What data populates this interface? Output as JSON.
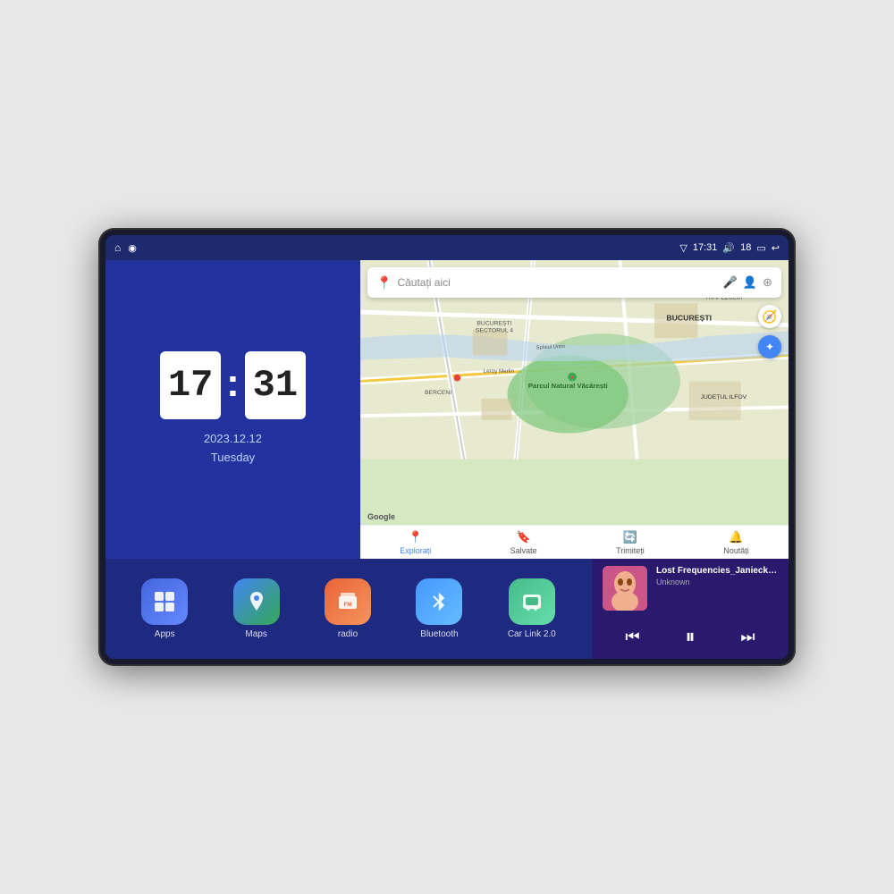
{
  "device": {
    "status_bar": {
      "signal_icon": "▽",
      "time": "17:31",
      "volume_icon": "🔊",
      "battery_level": "18",
      "battery_icon": "▭",
      "back_icon": "↩"
    },
    "home_icon": "⌂",
    "maps_icon": "◉"
  },
  "clock": {
    "hours": "17",
    "minutes": "31",
    "date": "2023.12.12",
    "day": "Tuesday"
  },
  "map": {
    "search_placeholder": "Căutați aici",
    "nav_items": [
      {
        "label": "Explorați",
        "icon": "📍",
        "active": true
      },
      {
        "label": "Salvate",
        "icon": "🔖",
        "active": false
      },
      {
        "label": "Trimiteți",
        "icon": "🔄",
        "active": false
      },
      {
        "label": "Noutăți",
        "icon": "🔔",
        "active": false
      }
    ],
    "locations": [
      "Parcul Natural Văcărești",
      "Leroy Merlin",
      "BUCUREȘTI",
      "JUDEȚUL ILFOV",
      "TRAPEZULUI",
      "BERCENI",
      "BUCUREȘTI SECTORUL 4",
      "Splaiul Unirii"
    ]
  },
  "apps": [
    {
      "id": "apps",
      "label": "Apps",
      "icon": "⊞",
      "color_class": "icon-apps"
    },
    {
      "id": "maps",
      "label": "Maps",
      "icon": "🗺",
      "color_class": "icon-maps"
    },
    {
      "id": "radio",
      "label": "radio",
      "icon": "📻",
      "color_class": "icon-radio"
    },
    {
      "id": "bluetooth",
      "label": "Bluetooth",
      "icon": "⚡",
      "color_class": "icon-bluetooth"
    },
    {
      "id": "carlink",
      "label": "Car Link 2.0",
      "icon": "📱",
      "color_class": "icon-carlink"
    }
  ],
  "music": {
    "title": "Lost Frequencies_Janieck Devy-...",
    "artist": "Unknown",
    "prev_icon": "⏮",
    "play_icon": "⏸",
    "next_icon": "⏭"
  }
}
